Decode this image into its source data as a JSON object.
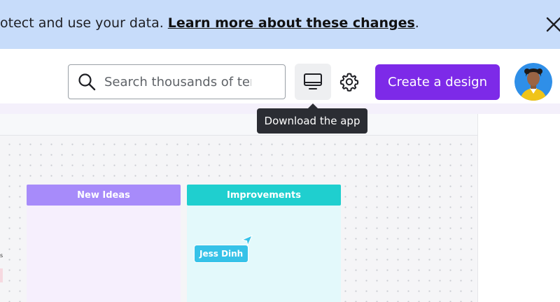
{
  "banner": {
    "text": "otect and use your data. ",
    "link": "Learn more about these changes",
    "suffix": "."
  },
  "header": {
    "search_placeholder": "Search thousands of templates",
    "create_label": "Create a design",
    "icons": {
      "search": "search-icon",
      "desktop": "desktop-icon",
      "settings": "gear-icon",
      "close": "close-icon"
    }
  },
  "tooltip": {
    "text": "Download the app"
  },
  "board": {
    "columns": [
      {
        "label": "New Ideas",
        "color": "#a78bfa"
      },
      {
        "label": "Improvements",
        "color": "#1fcfcf"
      }
    ],
    "collaborator": {
      "name": "Jess Dinh",
      "color": "#36c2e8"
    },
    "side_fragment": "s"
  },
  "colors": {
    "brand": "#7d2ae8",
    "banner_bg": "#c7dcfa",
    "tooltip_bg": "#2b2d33"
  }
}
